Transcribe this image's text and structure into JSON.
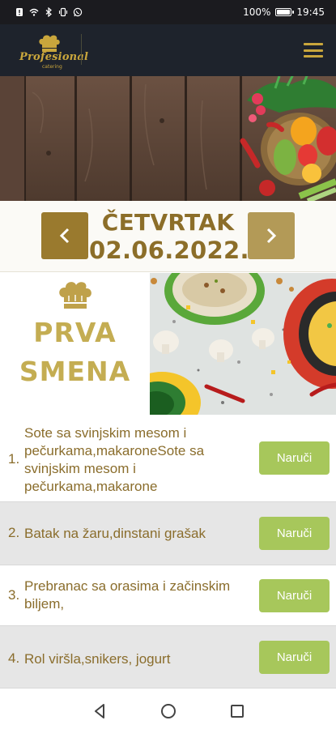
{
  "status_bar": {
    "battery_percent": "100%",
    "time": "19:45",
    "left_icons": [
      "notification-icon",
      "wifi-icon",
      "bluetooth-icon",
      "vibrate-icon",
      "whatsapp-icon"
    ]
  },
  "header": {
    "logo_text": "Profesional",
    "logo_subtext": "catering",
    "menu_icon": "hamburger-menu-icon"
  },
  "date_nav": {
    "day": "ČETVRTAK",
    "date": "02.06.2022.",
    "prev_icon": "chevron-left-icon",
    "next_icon": "chevron-right-icon"
  },
  "shift": {
    "title_line1": "PRVA",
    "title_line2": "SMENA"
  },
  "menu": {
    "order_label": "Naruči",
    "items": [
      {
        "number": "1.",
        "text": "Sote sa svinjskim mesom i pečurkama,makaroneSote sa svinjskim mesom i pečurkama,makarone"
      },
      {
        "number": "2.",
        "text": "Batak na žaru,dinstani grašak"
      },
      {
        "number": "3.",
        "text": "Prebranac sa orasima i začinskim biljem,"
      },
      {
        "number": "4.",
        "text": "Rol viršla,snikers, jogurt"
      }
    ]
  },
  "colors": {
    "gold": "#8c6e29",
    "gold_light": "#c4ad52",
    "header_bg": "#1e232c",
    "order_button": "#a7c75b"
  }
}
